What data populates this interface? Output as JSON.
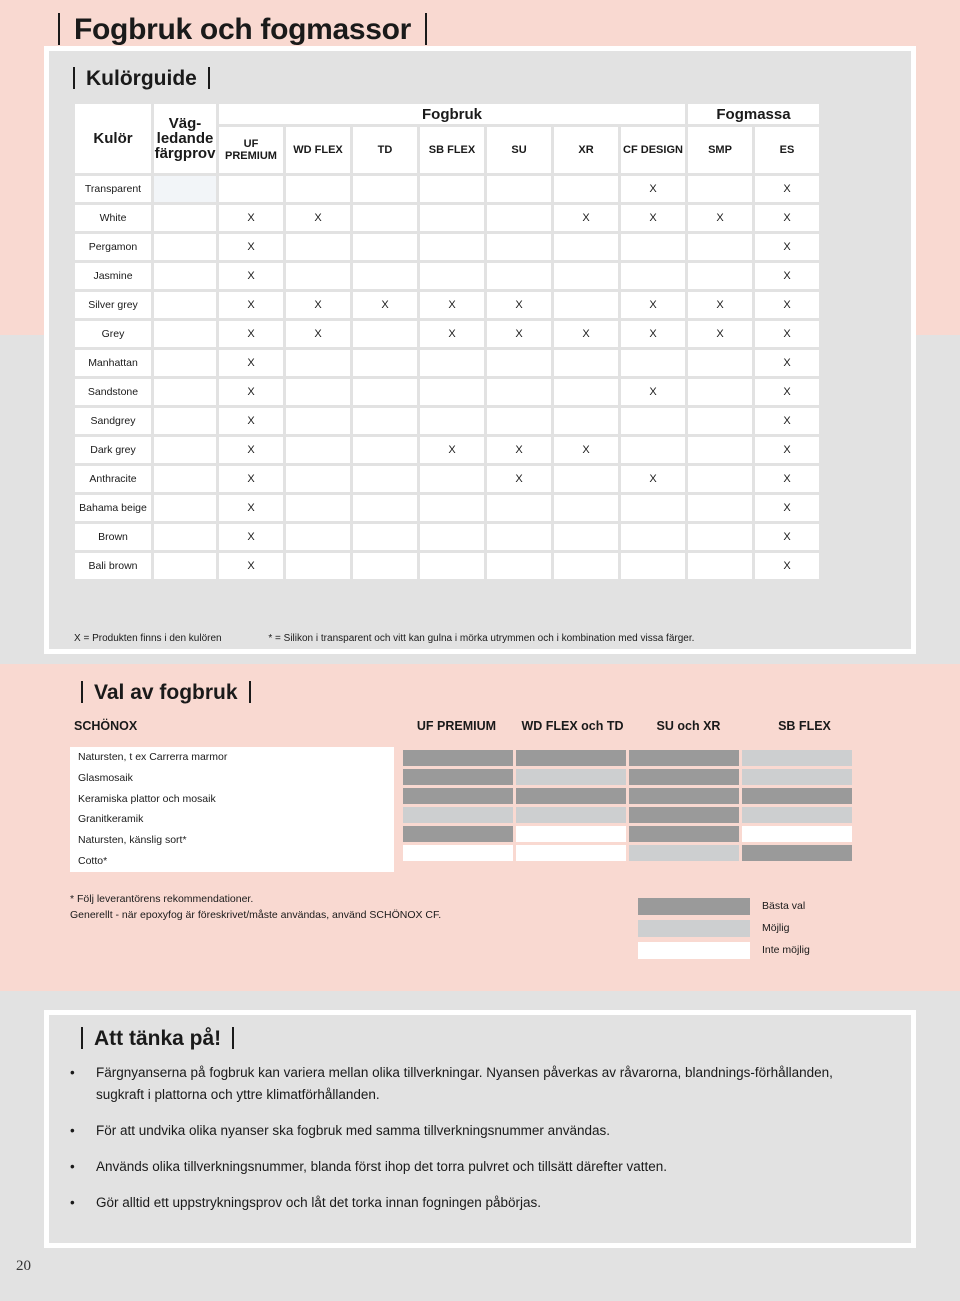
{
  "page": {
    "title": "Fogbruk och fogmassor",
    "folio": "20"
  },
  "colors": {
    "pink": "#f9d9d1",
    "grey_card": "#e2e2e2",
    "best": "#9a9a9a",
    "maybe": "#cdcfd0",
    "no": "#ffffff"
  },
  "kulorguide": {
    "heading": "Kulörguide",
    "col_kulor": "Kulör",
    "col_fargprov": "Väg-\nledande\nfärgprov",
    "group_fogbruk": "Fogbruk",
    "group_fogmassa": "Fogmassa",
    "columns": [
      "UF PREMIUM",
      "WD FLEX",
      "TD",
      "SB FLEX",
      "SU",
      "XR",
      "CF DESIGN",
      "SMP",
      "ES"
    ],
    "columns_line1": [
      "UF",
      "WD FLEX",
      "TD",
      "SB FLEX",
      "SU",
      "XR",
      "CF DESIGN",
      "SMP",
      "ES"
    ],
    "columns_line2": [
      "PREMIUM",
      "",
      "",
      "",
      "",
      "",
      "",
      "",
      ""
    ],
    "mark": "X",
    "rows": [
      {
        "name": "Transparent",
        "prov": false,
        "marks": [
          0,
          0,
          0,
          0,
          0,
          0,
          1,
          0,
          1
        ]
      },
      {
        "name": "White",
        "prov": true,
        "marks": [
          1,
          1,
          0,
          0,
          0,
          1,
          1,
          1,
          1
        ]
      },
      {
        "name": "Pergamon",
        "prov": true,
        "marks": [
          1,
          0,
          0,
          0,
          0,
          0,
          0,
          0,
          1
        ]
      },
      {
        "name": "Jasmine",
        "prov": true,
        "marks": [
          1,
          0,
          0,
          0,
          0,
          0,
          0,
          0,
          1
        ]
      },
      {
        "name": "Silver grey",
        "prov": true,
        "marks": [
          1,
          1,
          1,
          1,
          1,
          0,
          1,
          1,
          1
        ]
      },
      {
        "name": "Grey",
        "prov": true,
        "marks": [
          1,
          1,
          0,
          1,
          1,
          1,
          1,
          1,
          1
        ]
      },
      {
        "name": "Manhattan",
        "prov": true,
        "marks": [
          1,
          0,
          0,
          0,
          0,
          0,
          0,
          0,
          1
        ]
      },
      {
        "name": "Sandstone",
        "prov": true,
        "marks": [
          1,
          0,
          0,
          0,
          0,
          0,
          1,
          0,
          1
        ]
      },
      {
        "name": "Sandgrey",
        "prov": true,
        "marks": [
          1,
          0,
          0,
          0,
          0,
          0,
          0,
          0,
          1
        ]
      },
      {
        "name": "Dark grey",
        "prov": true,
        "marks": [
          1,
          0,
          0,
          1,
          1,
          1,
          0,
          0,
          1
        ]
      },
      {
        "name": "Anthracite",
        "prov": true,
        "marks": [
          1,
          0,
          0,
          0,
          1,
          0,
          1,
          0,
          1
        ]
      },
      {
        "name": "Bahama beige",
        "prov": true,
        "marks": [
          1,
          0,
          0,
          0,
          0,
          0,
          0,
          0,
          1
        ]
      },
      {
        "name": "Brown",
        "prov": true,
        "marks": [
          1,
          0,
          0,
          0,
          0,
          0,
          0,
          0,
          1
        ]
      },
      {
        "name": "Bali brown",
        "prov": true,
        "marks": [
          1,
          0,
          0,
          0,
          0,
          0,
          0,
          0,
          1
        ]
      }
    ],
    "legend_x": "X = Produkten finns i den kulören",
    "legend_star": "* = Silikon i transparent och vitt kan gulna i mörka utrymmen och i kombination med vissa färger."
  },
  "val_av_fogbruk": {
    "heading": "Val av fogbruk",
    "brand": "SCHÖNOX",
    "columns": [
      "UF PREMIUM",
      "WD FLEX och TD",
      "SU och XR",
      "SB FLEX"
    ],
    "rows": [
      {
        "name": "Natursten, t ex Carrerra marmor",
        "values": [
          "best",
          "best",
          "best",
          "maybe"
        ]
      },
      {
        "name": "Glasmosaik",
        "values": [
          "best",
          "maybe",
          "best",
          "maybe"
        ]
      },
      {
        "name": "Keramiska plattor och mosaik",
        "values": [
          "best",
          "best",
          "best",
          "best"
        ]
      },
      {
        "name": "Granitkeramik",
        "values": [
          "maybe",
          "maybe",
          "best",
          "maybe"
        ]
      },
      {
        "name": "Natursten, känslig sort*",
        "values": [
          "best",
          "no",
          "best",
          "no"
        ]
      },
      {
        "name": "Cotto*",
        "values": [
          "no",
          "no",
          "maybe",
          "best"
        ]
      }
    ],
    "note1": "* Följ leverantörens rekommendationer.",
    "note2": "Generellt - när epoxyfog är föreskrivet/måste användas, använd SCHÖNOX CF.",
    "key": [
      {
        "swatch": "best",
        "label": "Bästa val"
      },
      {
        "swatch": "maybe",
        "label": "Möjlig"
      },
      {
        "swatch": "no",
        "label": "Inte möjlig"
      }
    ]
  },
  "att_tanka_pa": {
    "heading": "Att tänka på!",
    "bullet": "•",
    "items": [
      "Färgnyanserna på fogbruk kan variera mellan olika tillverkningar. Nyansen påverkas av råvarorna, blandnings-förhållanden, sugkraft i plattorna och yttre klimatförhållanden.",
      "För att undvika olika nyanser ska fogbruk med samma tillverkningsnummer användas.",
      "Används olika tillverkningsnummer, blanda först ihop det torra pulvret och tillsätt därefter vatten.",
      "Gör alltid ett uppstrykningsprov och låt det torka innan fogningen påbörjas."
    ]
  }
}
